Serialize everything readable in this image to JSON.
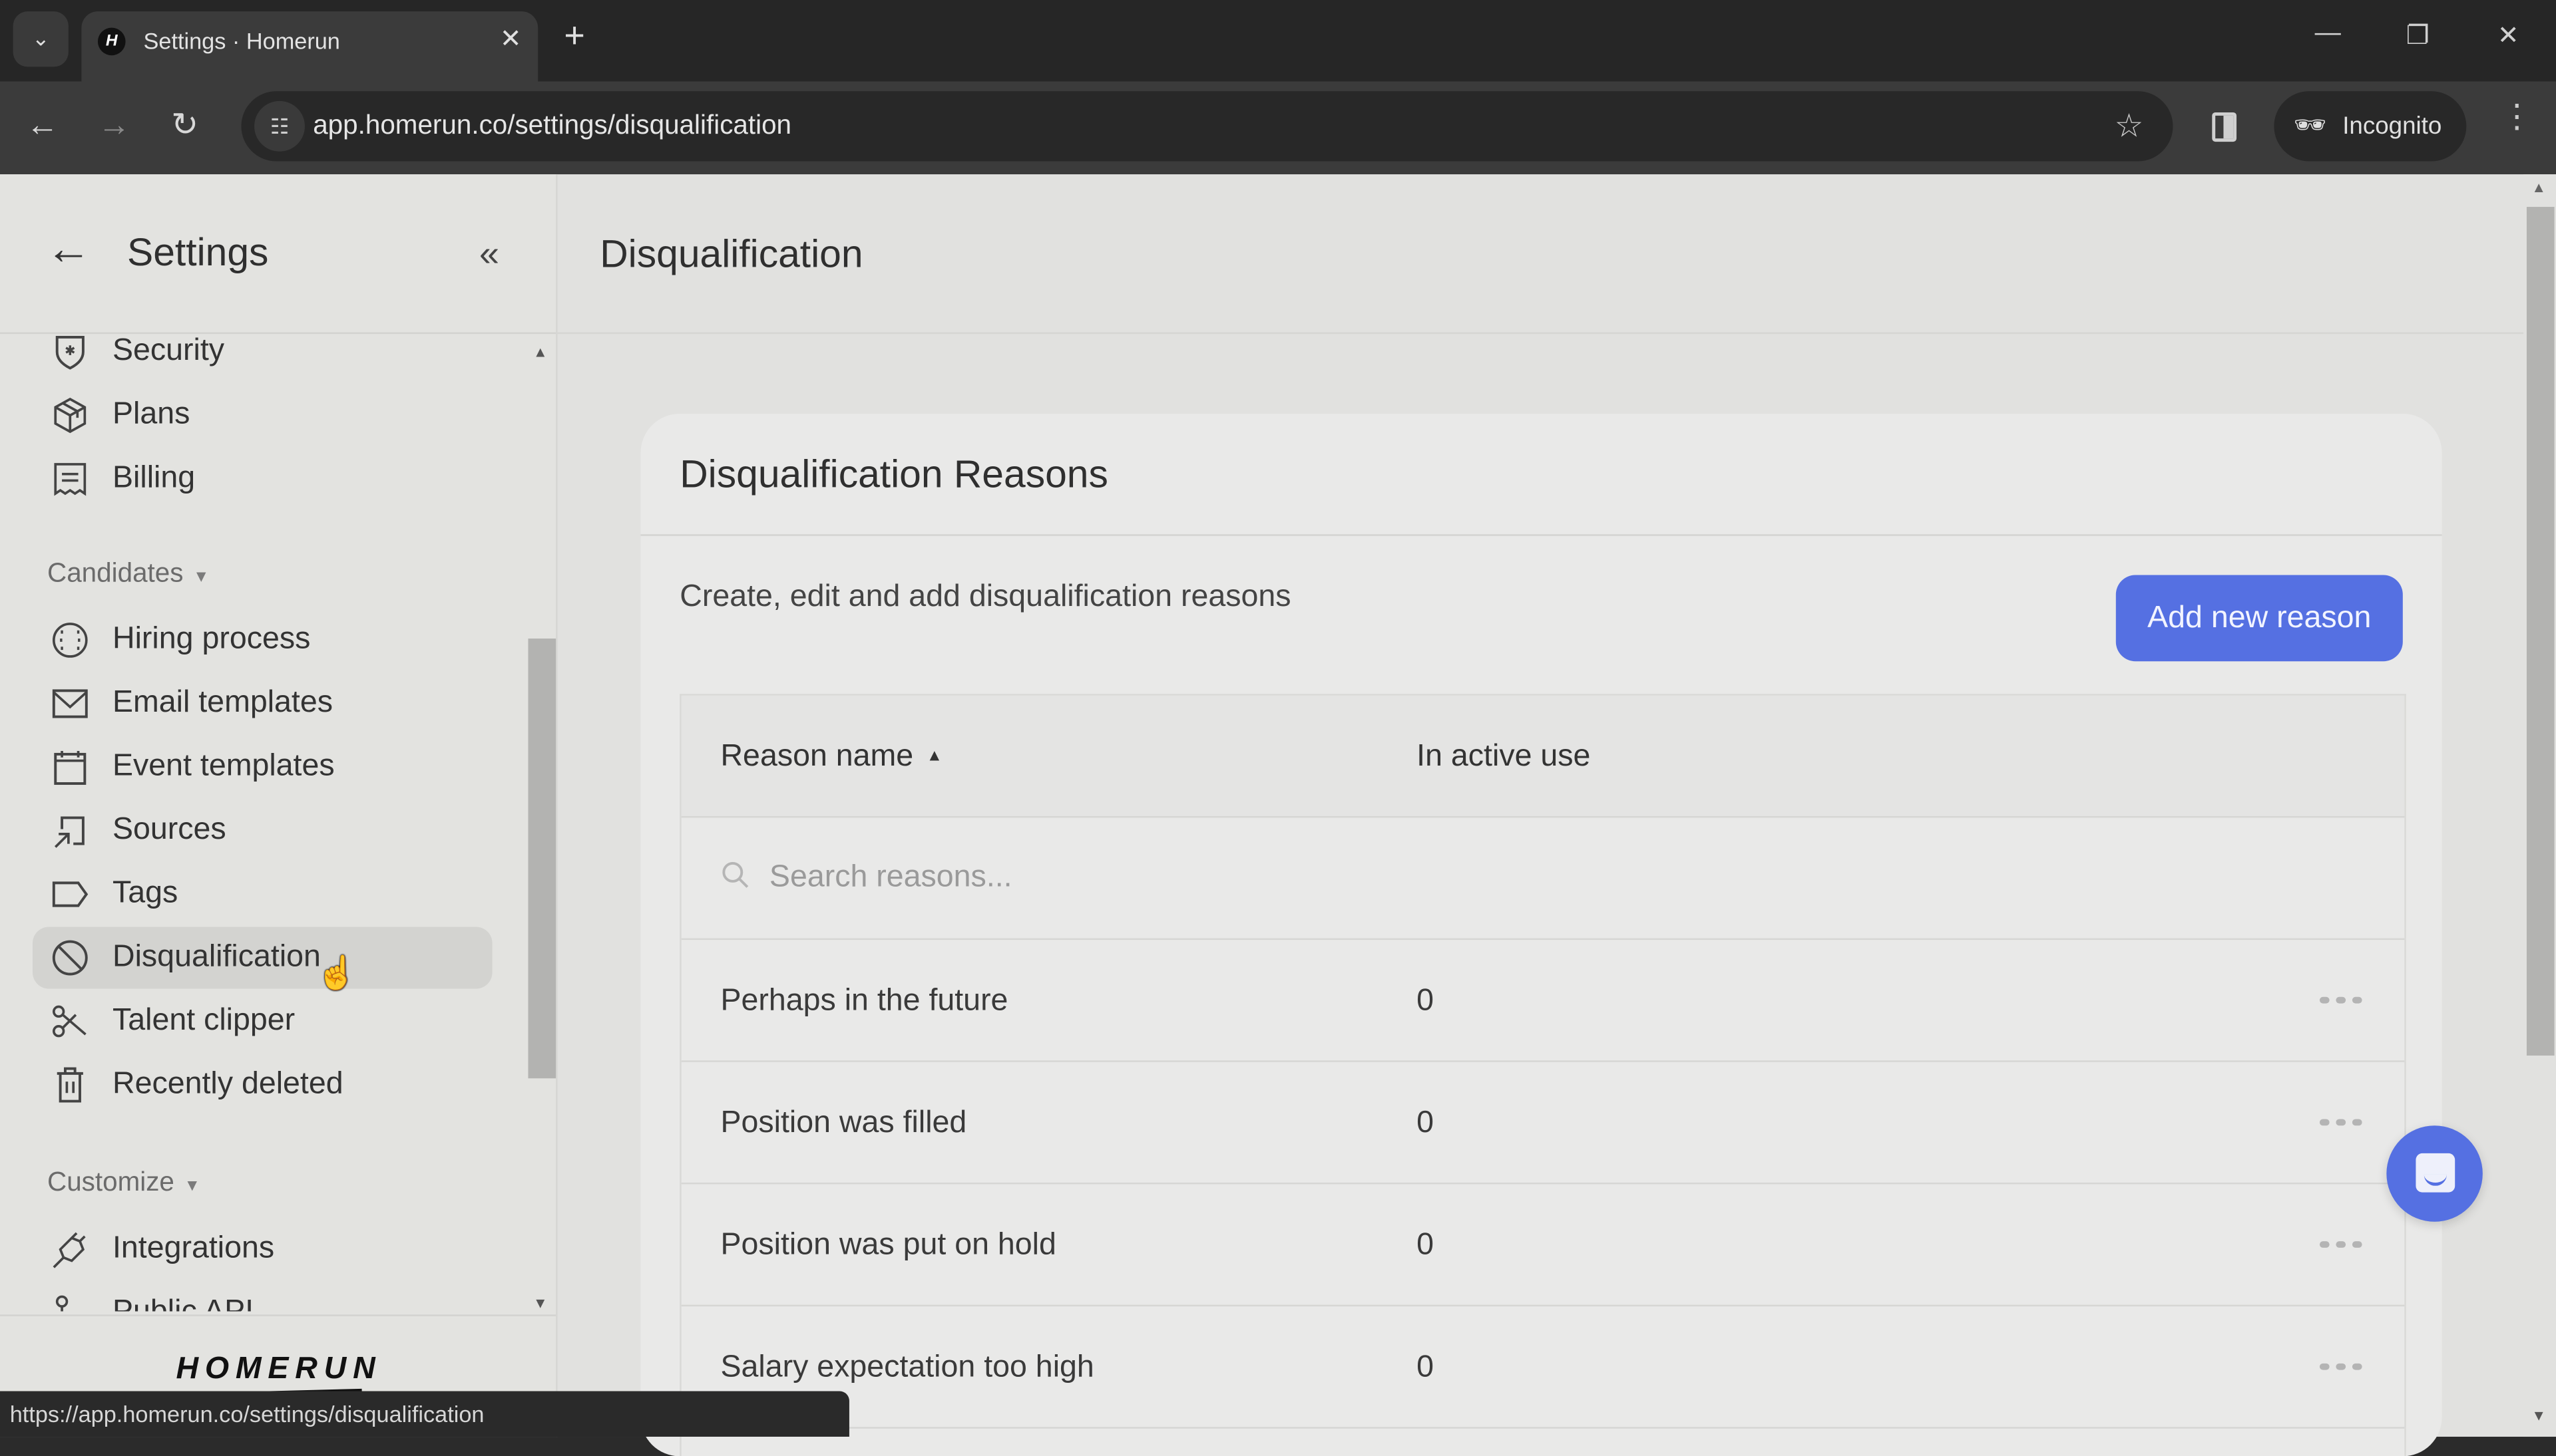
{
  "browser": {
    "tab_title": "Settings · Homerun",
    "favicon_letter": "H",
    "url": "app.homerun.co/settings/disqualification",
    "profile_label": "Incognito",
    "status_url": "https://app.homerun.co/settings/disqualification",
    "icons": {
      "tab_search": "chevron-down-icon",
      "close_tab": "close-icon",
      "new_tab": "plus-icon",
      "back": "arrow-left-icon",
      "forward": "arrow-right-icon",
      "reload": "reload-icon",
      "site_info": "tune-icon",
      "bookmark": "star-icon",
      "side_panel": "side-panel-icon",
      "incognito": "incognito-icon",
      "menu": "kebab-icon"
    }
  },
  "sidebar": {
    "title": "Settings",
    "logo": "HOMERUN",
    "groups": [
      {
        "label": "",
        "items": [
          {
            "label": "Security",
            "icon": "shield-icon"
          },
          {
            "label": "Plans",
            "icon": "box-icon"
          },
          {
            "label": "Billing",
            "icon": "receipt-icon"
          }
        ]
      },
      {
        "label": "Candidates",
        "items": [
          {
            "label": "Hiring process",
            "icon": "baseball-icon"
          },
          {
            "label": "Email templates",
            "icon": "envelope-icon"
          },
          {
            "label": "Event templates",
            "icon": "calendar-icon"
          },
          {
            "label": "Sources",
            "icon": "source-arrow-icon"
          },
          {
            "label": "Tags",
            "icon": "tag-icon"
          },
          {
            "label": "Disqualification",
            "icon": "ban-icon",
            "active": true
          },
          {
            "label": "Talent clipper",
            "icon": "scissors-icon"
          },
          {
            "label": "Recently deleted",
            "icon": "trash-icon"
          }
        ]
      },
      {
        "label": "Customize",
        "items": [
          {
            "label": "Integrations",
            "icon": "plug-icon"
          },
          {
            "label": "Public API",
            "icon": "api-icon"
          }
        ]
      }
    ]
  },
  "main": {
    "title": "Disqualification",
    "card": {
      "title": "Disqualification Reasons",
      "description": "Create, edit and add disqualification reasons",
      "add_button": "Add new reason",
      "table": {
        "columns": [
          "Reason name",
          "In active use"
        ],
        "sort": {
          "column": "Reason name",
          "direction": "ascending"
        },
        "search_placeholder": "Search reasons...",
        "search_value": "",
        "rows": [
          {
            "name": "Perhaps in the future",
            "in_active_use": "0"
          },
          {
            "name": "Position was filled",
            "in_active_use": "0"
          },
          {
            "name": "Position was put on hold",
            "in_active_use": "0"
          },
          {
            "name": "Salary expectation too high",
            "in_active_use": "0"
          }
        ]
      }
    }
  },
  "colors": {
    "accent": "#5570e2",
    "page_bg": "#e1e1df",
    "card_bg": "#e9e9e8",
    "active_item_bg": "#d3d3d0"
  }
}
